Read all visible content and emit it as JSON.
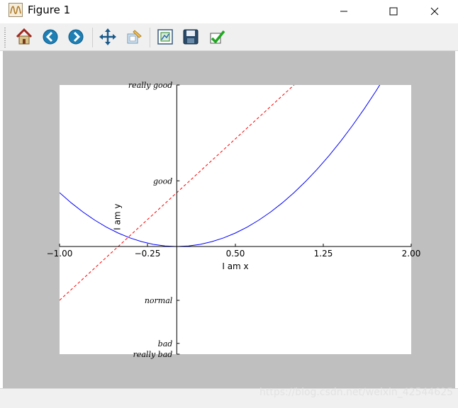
{
  "window": {
    "title": "Figure 1",
    "controls": [
      "minimize",
      "maximize",
      "close"
    ]
  },
  "toolbar": {
    "items": [
      {
        "icon": "home-icon",
        "tooltip": "Home"
      },
      {
        "icon": "back-icon",
        "tooltip": "Back"
      },
      {
        "icon": "forward-icon",
        "tooltip": "Forward"
      },
      {
        "icon": "pan-icon",
        "tooltip": "Pan"
      },
      {
        "icon": "zoom-icon",
        "tooltip": "Zoom"
      },
      {
        "icon": "subplots-icon",
        "tooltip": "Subplots"
      },
      {
        "icon": "save-icon",
        "tooltip": "Save"
      },
      {
        "icon": "edit-axes-icon",
        "tooltip": "Edit axes"
      }
    ]
  },
  "watermark": "https://blog.csdn.net/weixin_42544625",
  "chart_data": {
    "type": "line",
    "title": "",
    "xlabel": "I am x",
    "ylabel": "I am y",
    "xlim": [
      -1,
      2
    ],
    "ylim": [
      -2,
      3
    ],
    "xticks": [
      -1.0,
      -0.25,
      0.5,
      1.25,
      2.0
    ],
    "xtick_labels": [
      "−1.00",
      "−0.25",
      "0.50",
      "1.25",
      "2.00"
    ],
    "yticks": [
      -1.8,
      -1,
      1.22,
      3
    ],
    "ytick_labels": [
      "bad",
      "normal",
      "good",
      "really good"
    ],
    "ytick_extra": {
      "value": -2,
      "label": "really bad"
    },
    "spines": "centered at data origin",
    "grid": false,
    "series": [
      {
        "x": [
          -1.0,
          -0.9,
          -0.8,
          -0.7,
          -0.6,
          -0.5,
          -0.4,
          -0.3,
          -0.2,
          -0.1,
          0.0,
          0.1,
          0.2,
          0.3,
          0.4,
          0.5,
          0.6,
          0.7,
          0.8,
          0.9,
          1.0,
          1.1,
          1.2,
          1.3,
          1.4,
          1.5,
          1.6,
          1.7,
          1.8,
          1.9,
          2.0
        ],
        "values": [
          1.0,
          0.81,
          0.64,
          0.49,
          0.36,
          0.25,
          0.16,
          0.09,
          0.04,
          0.01,
          0.0,
          0.01,
          0.04,
          0.09,
          0.16,
          0.25,
          0.36,
          0.49,
          0.64,
          0.81,
          1.0,
          1.21,
          1.44,
          1.69,
          1.96,
          2.25,
          2.56,
          2.89,
          3.24,
          3.61,
          4.0
        ],
        "color": "#0000ff",
        "style": "solid"
      },
      {
        "x": [
          -1.0,
          2.0
        ],
        "values": [
          -1.0,
          5.0
        ],
        "color": "#ff0000",
        "style": "dashed"
      }
    ]
  }
}
